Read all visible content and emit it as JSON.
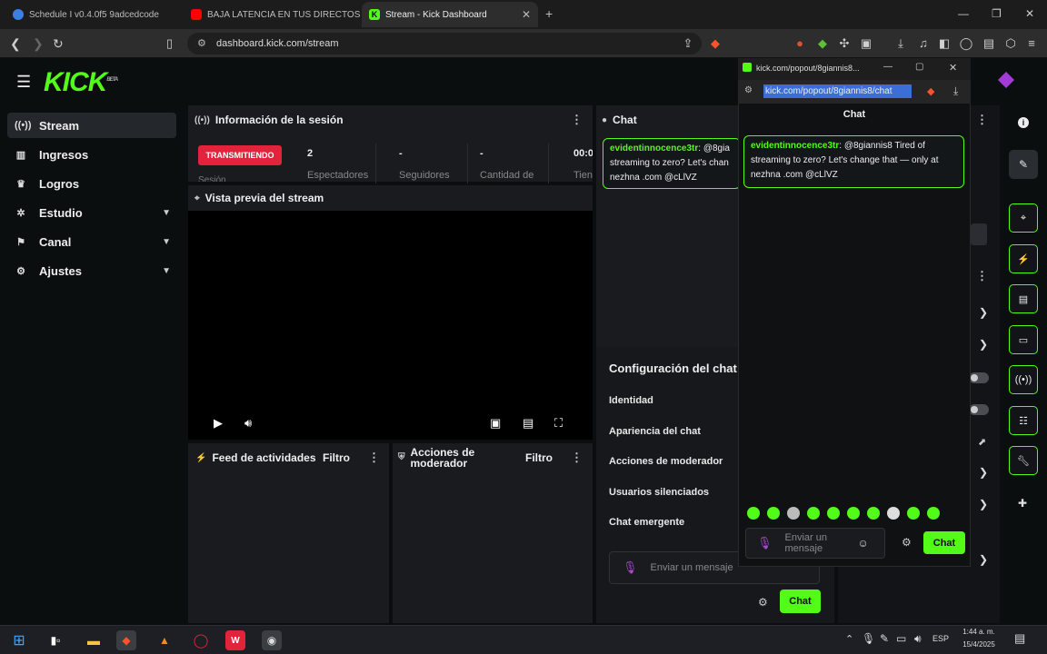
{
  "browser": {
    "tabs": [
      {
        "title": "Schedule I v0.4.0f5 9adcedcode",
        "fav_color": "#3b7fe0"
      },
      {
        "title": "BAJA LATENCIA EN TUS DIRECTOS !!",
        "fav_color": "#ff0000"
      },
      {
        "title": "Stream - Kick Dashboard",
        "fav_color": "#53fc18"
      }
    ],
    "new_tab": "+",
    "url": "dashboard.kick.com/stream"
  },
  "brand": {
    "logo": "KICK",
    "logo_sup": "BETA",
    "accent": "#53fc18"
  },
  "sidebar": {
    "items": [
      {
        "label": "Stream",
        "icon": "broadcast-icon"
      },
      {
        "label": "Ingresos",
        "icon": "wallet-icon"
      },
      {
        "label": "Logros",
        "icon": "trophy-icon"
      },
      {
        "label": "Estudio",
        "icon": "studio-icon"
      },
      {
        "label": "Canal",
        "icon": "channel-icon"
      },
      {
        "label": "Ajustes",
        "icon": "gear-icon"
      }
    ]
  },
  "session": {
    "title": "Información de la sesión",
    "status": "TRANSMITIENDO",
    "status_sub": "Sesión",
    "status_color": "#e2233b",
    "stats": [
      {
        "value": "2",
        "label": "Espectadores"
      },
      {
        "value": "-",
        "label": "Seguidores"
      },
      {
        "value": "-",
        "label": "Cantidad de"
      },
      {
        "value": "00:0",
        "label": "Tien"
      }
    ]
  },
  "preview": {
    "title": "Vista previa del stream"
  },
  "feed": {
    "title": "Feed de actividades",
    "filter": "Filtro"
  },
  "modactions": {
    "title": "Acciones de moderador",
    "filter": "Filtro"
  },
  "chat": {
    "title": "Chat",
    "message": {
      "user": "evidentinnocence3tr",
      "text": ": @8gia streaming to zero? Let's chan nezhna .com @cLlVZ"
    },
    "settings_title": "Configuración del chat",
    "settings": [
      "Identidad",
      "Apariencia del chat",
      "Acciones de moderador",
      "Usuarios silenciados",
      "Chat emergente"
    ],
    "input_placeholder": "Enviar un mensaje",
    "send": "Chat"
  },
  "popup": {
    "window_title": "kick.com/popout/8giannis8...",
    "url": "kick.com/popout/8giannis8/chat",
    "heading": "Chat",
    "message": {
      "user": "evidentinnocence3tr",
      "text": ": @8giannis8 Tired of streaming to zero? Let's change that — only at nezhna .com @cLlVZ"
    },
    "input_placeholder": "Enviar un mensaje",
    "send": "Chat"
  },
  "taskbar": {
    "lang": "ESP",
    "time": "1:44 a. m.",
    "date": "15/4/2025"
  }
}
